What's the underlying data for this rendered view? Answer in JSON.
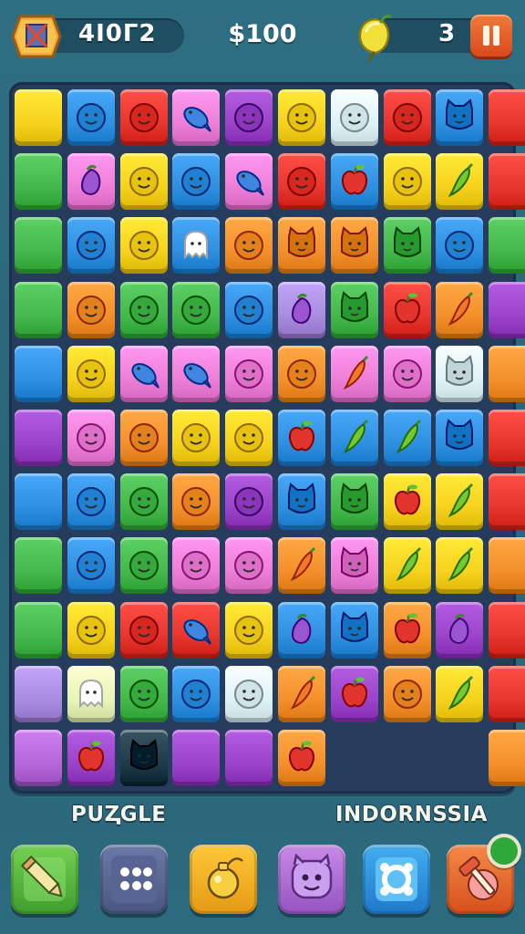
{
  "header": {
    "level_code": "4I0Γ2",
    "score": "$100",
    "moves": "3",
    "menu_icon": "crossed-box-icon",
    "lemon_icon": "lemon-icon",
    "pause_icon": "pause-icon"
  },
  "board": {
    "rows": [
      [
        "yellow",
        "blue:smile",
        "red:smile",
        "pink:fish",
        "purple:smile",
        "yellow:smile",
        "white:smile",
        "red:smile",
        "blue:cat",
        "red"
      ],
      [
        "green",
        "pink:eggplant",
        "yellow:smile",
        "blue:smile",
        "pink:fish",
        "red:smile",
        "blue:apple",
        "yellow:smile",
        "yellow:pepper",
        "red"
      ],
      [
        "green",
        "blue:smile",
        "yellow:smile",
        "blue:ghost",
        "orange:smile",
        "orange:cat",
        "orange:cat",
        "green:cat",
        "blue:smile",
        "green"
      ],
      [
        "green",
        "orange:smile",
        "green:smile",
        "green:smile",
        "blue:smile",
        "lavender:eggplant",
        "green:cat",
        "red:apple",
        "orange:pepper",
        "purple"
      ],
      [
        "blue",
        "yellow:smile",
        "pink:fish",
        "pink:fish",
        "pink:smile",
        "orange:smile",
        "pink:pepper",
        "pink:smile",
        "white:cat",
        "orange"
      ],
      [
        "purple",
        "pink:smile",
        "orange:smile",
        "yellow:smile",
        "yellow:smile",
        "blue:apple",
        "blue:pepper",
        "blue:pepper",
        "blue:cat",
        "red"
      ],
      [
        "blue",
        "blue:smile",
        "green:smile",
        "orange:smile",
        "purple:smile",
        "blue:cat",
        "green:cat",
        "yellow:apple",
        "yellow:pepper",
        "red"
      ],
      [
        "green",
        "blue:smile",
        "green:smile",
        "pink:smile",
        "pink:smile",
        "orange:pepper",
        "pink:cat",
        "yellow:pepper",
        "yellow:pepper",
        "orange"
      ],
      [
        "green",
        "yellow:smile",
        "red:smile",
        "red:fish",
        "yellow:smile",
        "blue:eggplant",
        "blue:cat",
        "orange:apple",
        "purple:eggplant",
        "red"
      ],
      [
        "lavender",
        "lime:ghost",
        "green:smile",
        "blue:smile",
        "white:smile",
        "orange:pepper",
        "purple:apple",
        "orange:smile",
        "yellow:pepper",
        "red"
      ],
      [
        "violet",
        "purple:apple",
        "dark:cat",
        "purple",
        "purple",
        "orange:apple",
        "",
        "",
        "",
        "orange"
      ]
    ]
  },
  "footer": {
    "left_label": "PUⱫGLE",
    "right_label": "INDORNSSIA",
    "buttons": [
      {
        "name": "pencil",
        "icon": "pencil-icon",
        "color": "#5fbf45"
      },
      {
        "name": "dots",
        "icon": "dots-grid-icon",
        "color": "#5b6b96"
      },
      {
        "name": "bomb",
        "icon": "bomb-icon",
        "color": "#f2b21f"
      },
      {
        "name": "monster",
        "icon": "monster-face-icon",
        "color": "#b46fd8"
      },
      {
        "name": "shuffle",
        "icon": "shuffle-ring-icon",
        "color": "#2e8fd6"
      },
      {
        "name": "hammer",
        "icon": "hammer-icon",
        "color": "#f06a2e"
      }
    ]
  },
  "colors": {
    "yellow": "#f6d21e",
    "blue": "#2f8fe0",
    "red": "#e6362e",
    "pink": "#ee7fd8",
    "purple": "#9b43c9",
    "white": "#dff2f6",
    "green": "#44b84a",
    "orange": "#f4902c",
    "lavender": "#a98be0",
    "lime": "#e6f4b8",
    "violet": "#b567d8",
    "dark": "#1f3b4a"
  }
}
